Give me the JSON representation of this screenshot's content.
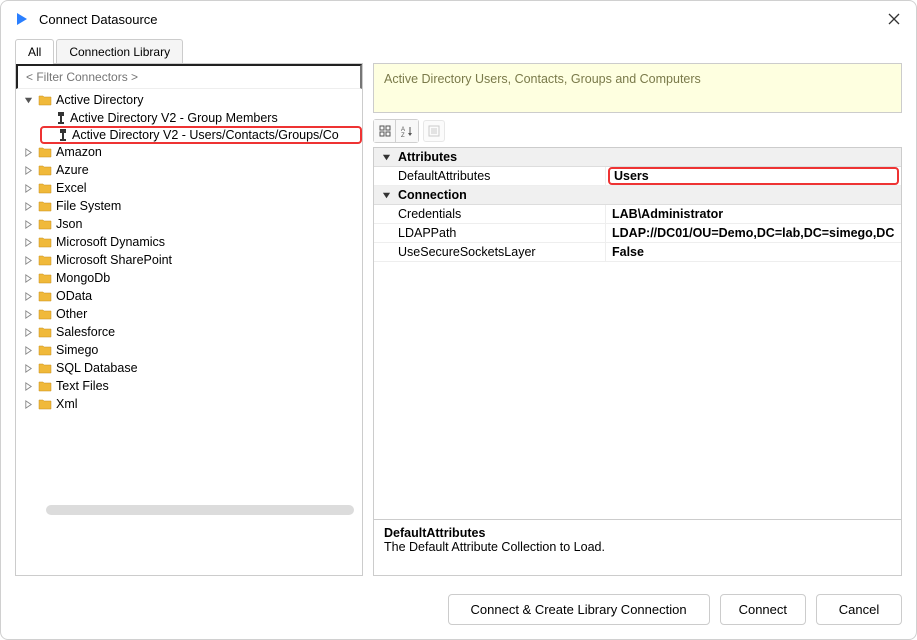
{
  "window": {
    "title": "Connect Datasource"
  },
  "tabs": {
    "all": "All",
    "library": "Connection Library"
  },
  "filter": {
    "placeholder": "< Filter Connectors >"
  },
  "tree": {
    "root": {
      "label": "Active Directory",
      "children": [
        {
          "label": "Active Directory V2 - Group Members"
        },
        {
          "label": "Active Directory V2 - Users/Contacts/Groups/Co"
        }
      ]
    },
    "folders": [
      "Amazon",
      "Azure",
      "Excel",
      "File System",
      "Json",
      "Microsoft Dynamics",
      "Microsoft SharePoint",
      "MongoDb",
      "OData",
      "Other",
      "Salesforce",
      "Simego",
      "SQL Database",
      "Text Files",
      "Xml"
    ]
  },
  "desc": "Active Directory Users, Contacts, Groups and Computers",
  "props": {
    "cat1": "Attributes",
    "cat2": "Connection",
    "rows": {
      "defaultAttributes": {
        "key": "DefaultAttributes",
        "val": "Users"
      },
      "credentials": {
        "key": "Credentials",
        "val": "LAB\\Administrator"
      },
      "ldapPath": {
        "key": "LDAPPath",
        "val": "LDAP://DC01/OU=Demo,DC=lab,DC=simego,DC"
      },
      "useSSL": {
        "key": "UseSecureSocketsLayer",
        "val": "False"
      }
    }
  },
  "help": {
    "title": "DefaultAttributes",
    "text": "The Default Attribute Collection to Load."
  },
  "buttons": {
    "createLib": "Connect & Create Library Connection",
    "connect": "Connect",
    "cancel": "Cancel"
  }
}
